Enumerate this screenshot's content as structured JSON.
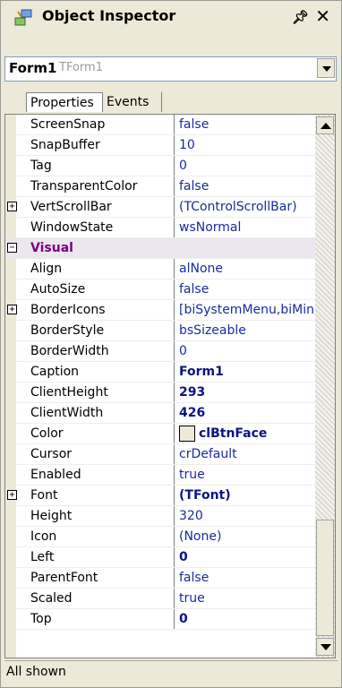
{
  "window": {
    "title": "Object Inspector",
    "pin_label": "✤",
    "close_label": "✕"
  },
  "object_selector": {
    "name": "Form1",
    "type": "TForm1"
  },
  "tabs": [
    {
      "label": "Properties"
    },
    {
      "label": "Events"
    }
  ],
  "properties": [
    {
      "name": "ScreenSnap",
      "value": "false"
    },
    {
      "name": "SnapBuffer",
      "value": "10"
    },
    {
      "name": "Tag",
      "value": "0"
    },
    {
      "name": "TransparentColor",
      "value": "false"
    },
    {
      "name": "VertScrollBar",
      "value": "(TControlScrollBar)",
      "expander": "+"
    },
    {
      "name": "WindowState",
      "value": "wsNormal"
    },
    {
      "name": "Visual",
      "value": "",
      "category": true,
      "expander": "−"
    },
    {
      "name": "Align",
      "value": "alNone"
    },
    {
      "name": "AutoSize",
      "value": "false"
    },
    {
      "name": "BorderIcons",
      "value": "[biSystemMenu,biMinimize,biMaximize]",
      "expander": "+"
    },
    {
      "name": "BorderStyle",
      "value": "bsSizeable"
    },
    {
      "name": "BorderWidth",
      "value": "0"
    },
    {
      "name": "Caption",
      "value": "Form1",
      "bold": true
    },
    {
      "name": "ClientHeight",
      "value": "293",
      "bold": true
    },
    {
      "name": "ClientWidth",
      "value": "426",
      "bold": true
    },
    {
      "name": "Color",
      "value": "clBtnFace",
      "bold": true,
      "swatch": "#ece9d8"
    },
    {
      "name": "Cursor",
      "value": "crDefault"
    },
    {
      "name": "Enabled",
      "value": "true"
    },
    {
      "name": "Font",
      "value": "(TFont)",
      "bold": true,
      "expander": "+"
    },
    {
      "name": "Height",
      "value": "320"
    },
    {
      "name": "Icon",
      "value": "(None)"
    },
    {
      "name": "Left",
      "value": "0",
      "bold": true
    },
    {
      "name": "ParentFont",
      "value": "false"
    },
    {
      "name": "Scaled",
      "value": "true"
    },
    {
      "name": "Top",
      "value": "0",
      "bold": true
    }
  ],
  "status": {
    "text": "All shown"
  },
  "colors": {
    "value_text": "#1a2aa0",
    "bold_value_text": "#0b1480",
    "category_text": "#7a0080",
    "category_bg": "#ebe7ee",
    "window_bg": "#ece9d8"
  },
  "icons": {
    "title": "object-inspector-icon",
    "pin": "pin-icon",
    "close": "close-icon",
    "combo": "chevron-down-icon",
    "expand": "plus-box-icon",
    "collapse": "minus-box-icon",
    "scroll_up": "scroll-up-arrow-icon",
    "scroll_down": "scroll-down-arrow-icon"
  }
}
